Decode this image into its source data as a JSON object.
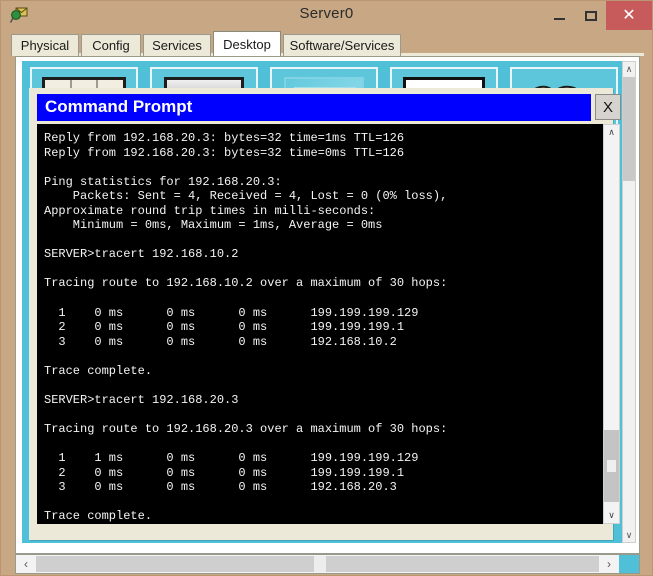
{
  "window": {
    "title": "Server0",
    "icon": "packet-tracer-device-icon",
    "controls": {
      "minimize": "—",
      "maximize": "☐",
      "close": "×"
    }
  },
  "tabs": [
    {
      "label": "Physical",
      "active": false
    },
    {
      "label": "Config",
      "active": false
    },
    {
      "label": "Services",
      "active": false
    },
    {
      "label": "Desktop",
      "active": true
    },
    {
      "label": "Software/Services",
      "active": false
    }
  ],
  "desktop": {
    "background_color": "#4fc0d8",
    "tiles": [
      {
        "name": "ip-configuration-icon"
      },
      {
        "name": "dial-up-icon"
      },
      {
        "name": "terminal-icon"
      },
      {
        "name": "command-prompt-icon"
      },
      {
        "name": "web-browser-icon"
      }
    ]
  },
  "command_prompt": {
    "title": "Command Prompt",
    "close_label": "X",
    "title_bar_color": "#0000ff",
    "background_color": "#000000",
    "text_color": "#f4f4f4",
    "output": "Reply from 192.168.20.3: bytes=32 time=1ms TTL=126\nReply from 192.168.20.3: bytes=32 time=0ms TTL=126\n\nPing statistics for 192.168.20.3:\n    Packets: Sent = 4, Received = 4, Lost = 0 (0% loss),\nApproximate round trip times in milli-seconds:\n    Minimum = 0ms, Maximum = 1ms, Average = 0ms\n\nSERVER>tracert 192.168.10.2\n\nTracing route to 192.168.10.2 over a maximum of 30 hops:\n\n  1    0 ms      0 ms      0 ms      199.199.199.129\n  2    0 ms      0 ms      0 ms      199.199.199.1\n  3    0 ms      0 ms      0 ms      192.168.10.2\n\nTrace complete.\n\nSERVER>tracert 192.168.20.3\n\nTracing route to 192.168.20.3 over a maximum of 30 hops:\n\n  1    1 ms      0 ms      0 ms      199.199.199.129\n  2    0 ms      0 ms      0 ms      199.199.199.1\n  3    0 ms      0 ms      0 ms      192.168.20.3\n\nTrace complete.\n\nSERVER>",
    "prompt": "SERVER>",
    "ping_statistics": {
      "target": "192.168.20.3",
      "sent": 4,
      "received": 4,
      "lost": 0,
      "loss_percent": "0%",
      "minimum_ms": 0,
      "maximum_ms": 1,
      "average_ms": 0
    },
    "traceroutes": [
      {
        "command": "tracert 192.168.10.2",
        "target": "192.168.10.2",
        "max_hops": 30,
        "hops": [
          {
            "n": 1,
            "t1": "0 ms",
            "t2": "0 ms",
            "t3": "0 ms",
            "address": "199.199.199.129"
          },
          {
            "n": 2,
            "t1": "0 ms",
            "t2": "0 ms",
            "t3": "0 ms",
            "address": "199.199.199.1"
          },
          {
            "n": 3,
            "t1": "0 ms",
            "t2": "0 ms",
            "t3": "0 ms",
            "address": "192.168.10.2"
          }
        ],
        "status": "Trace complete."
      },
      {
        "command": "tracert 192.168.20.3",
        "target": "192.168.20.3",
        "max_hops": 30,
        "hops": [
          {
            "n": 1,
            "t1": "1 ms",
            "t2": "0 ms",
            "t3": "0 ms",
            "address": "199.199.199.129"
          },
          {
            "n": 2,
            "t1": "0 ms",
            "t2": "0 ms",
            "t3": "0 ms",
            "address": "199.199.199.1"
          },
          {
            "n": 3,
            "t1": "0 ms",
            "t2": "0 ms",
            "t3": "0 ms",
            "address": "192.168.20.3"
          }
        ],
        "status": "Trace complete."
      }
    ],
    "scrollbar": {
      "up_arrow": "∧",
      "down_arrow": "∨"
    }
  },
  "desktop_scrollbars": {
    "vertical": {
      "up_arrow": "∧",
      "down_arrow": "∨"
    },
    "horizontal": {
      "left_arrow": "‹",
      "right_arrow": "›"
    }
  }
}
